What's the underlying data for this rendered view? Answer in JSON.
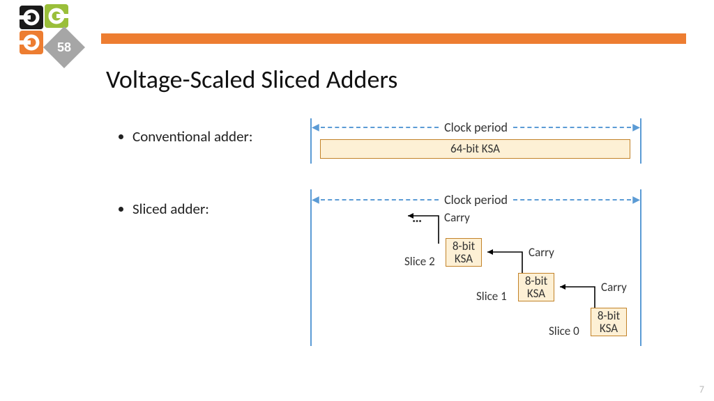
{
  "title": "Voltage-Scaled Sliced Adders",
  "bullets": {
    "b1": "Conventional adder:",
    "b2": "Sliced adder:"
  },
  "clock": "Clock period",
  "ksa": {
    "big": "64-bit KSA",
    "small1": "8-bit",
    "small2": "KSA"
  },
  "labels": {
    "slice2": "Slice 2",
    "slice1": "Slice 1",
    "slice0": "Slice 0",
    "carry": "Carry",
    "dots": "…"
  },
  "page": "7"
}
